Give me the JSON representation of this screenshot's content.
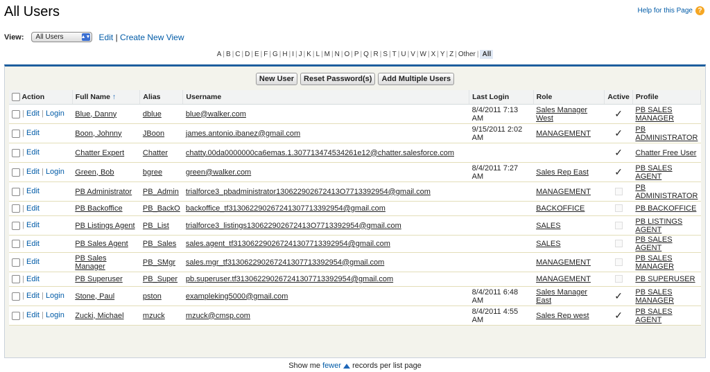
{
  "header": {
    "title": "All Users",
    "help": "Help for this Page"
  },
  "view": {
    "label": "View:",
    "selected": "All Users",
    "edit": "Edit",
    "sep": "|",
    "create": "Create New View"
  },
  "alphabet": [
    "A",
    "B",
    "C",
    "D",
    "E",
    "F",
    "G",
    "H",
    "I",
    "J",
    "K",
    "L",
    "M",
    "N",
    "O",
    "P",
    "Q",
    "R",
    "S",
    "T",
    "U",
    "V",
    "W",
    "X",
    "Y",
    "Z",
    "Other",
    "All"
  ],
  "buttons": {
    "new_user": "New User",
    "reset_password": "Reset Password(s)",
    "add_multiple": "Add Multiple Users"
  },
  "columns": [
    "Action",
    "Full Name",
    "Alias",
    "Username",
    "Last Login",
    "Role",
    "Active",
    "Profile"
  ],
  "sort_indicator": "↑",
  "row_actions": {
    "sep": "|",
    "edit": "Edit",
    "login": "Login"
  },
  "rows": [
    {
      "name": "Blue, Danny",
      "alias": "dblue",
      "username": "blue@walker.com",
      "last_login": "8/4/2011 7:13 AM",
      "role": "Sales Manager West",
      "active": true,
      "profile": "PB SALES MANAGER",
      "login": true
    },
    {
      "name": "Boon, Johnny",
      "alias": "JBoon",
      "username": "james.antonio.ibanez@gmail.com",
      "last_login": "9/15/2011 2:02 AM",
      "role": "MANAGEMENT",
      "active": true,
      "profile": "PB ADMINISTRATOR",
      "login": false
    },
    {
      "name": "Chatter Expert",
      "alias": "Chatter",
      "username": "chatty.00da0000000ca6emas.1.307713474534261e12@chatter.salesforce.com",
      "last_login": "",
      "role": "",
      "active": true,
      "profile": "Chatter Free User",
      "login": false
    },
    {
      "name": "Green, Bob",
      "alias": "bgree",
      "username": "green@walker.com",
      "last_login": "8/4/2011 7:27 AM",
      "role": "Sales Rep East",
      "active": true,
      "profile": "PB SALES AGENT",
      "login": true
    },
    {
      "name": "PB Administrator",
      "alias": "PB_Admin",
      "username": "trialforce3_pbadministrator130622902672413O7713392954@gmail.com",
      "last_login": "",
      "role": "MANAGEMENT",
      "active": false,
      "profile": "PB ADMINISTRATOR",
      "login": false
    },
    {
      "name": "PB Backoffice",
      "alias": "PB_BackO",
      "username": "backoffice_tf313062290267241307713392954@gmail.com",
      "last_login": "",
      "role": "BACKOFFICE",
      "active": false,
      "profile": "PB BACKOFFICE",
      "login": false
    },
    {
      "name": "PB Listings Agent",
      "alias": "PB_List",
      "username": "trialforce3_listings130622902672413O7713392954@gmail.com",
      "last_login": "",
      "role": "SALES",
      "active": false,
      "profile": "PB LISTINGS AGENT",
      "login": false
    },
    {
      "name": "PB Sales Agent",
      "alias": "PB_Sales",
      "username": "sales.agent_tf313062290267241307713392954@gmail.com",
      "last_login": "",
      "role": "SALES",
      "active": false,
      "profile": "PB SALES AGENT",
      "login": false
    },
    {
      "name": "PB Sales Manager",
      "alias": "PB_SMgr",
      "username": "sales.mgr_tf313062290267241307713392954@gmail.com",
      "last_login": "",
      "role": "MANAGEMENT",
      "active": false,
      "profile": "PB SALES MANAGER",
      "login": false
    },
    {
      "name": "PB Superuser",
      "alias": "PB_Super",
      "username": "pb.superuser.tf313062290267241307713392954@gmail.com",
      "last_login": "",
      "role": "MANAGEMENT",
      "active": false,
      "profile": "PB SUPERUSER",
      "login": false
    },
    {
      "name": "Stone, Paul",
      "alias": "pston",
      "username": "exampleking5000@gmail.com",
      "last_login": "8/4/2011 6:48 AM",
      "role": "Sales Manager East",
      "active": true,
      "profile": "PB SALES MANAGER",
      "login": true
    },
    {
      "name": "Zucki, Michael",
      "alias": "mzuck",
      "username": "mzuck@cmsp.com",
      "last_login": "8/4/2011 4:55 AM",
      "role": "Sales Rep west",
      "active": true,
      "profile": "PB SALES AGENT",
      "login": true
    }
  ],
  "footer": {
    "pre": "Show me",
    "link": "fewer",
    "post": "records per list page"
  }
}
